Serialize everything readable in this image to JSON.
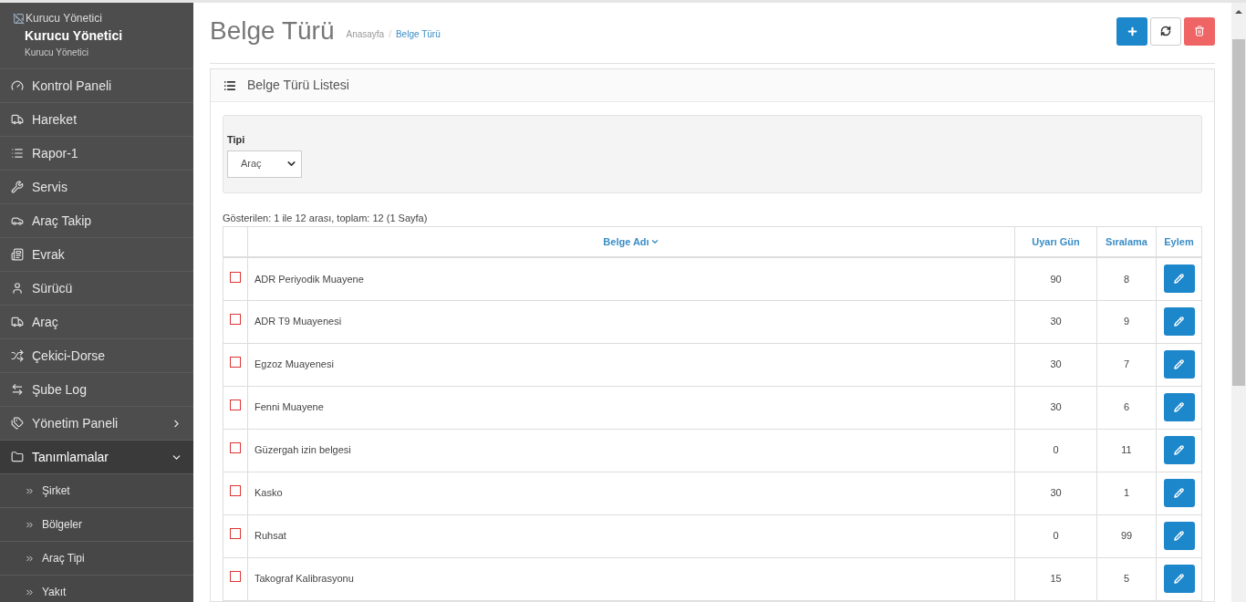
{
  "user": {
    "image_alt": "Kurucu Yönetici",
    "name": "Kurucu Yönetici",
    "role": "Kurucu Yönetici"
  },
  "sidebar": {
    "items": [
      {
        "label": "Kontrol Paneli",
        "selected": false
      },
      {
        "label": "Hareket",
        "selected": false
      },
      {
        "label": "Rapor-1",
        "selected": false
      },
      {
        "label": "Servis",
        "selected": false
      },
      {
        "label": "Araç Takip",
        "selected": false
      },
      {
        "label": "Evrak",
        "selected": false
      },
      {
        "label": "Sürücü",
        "selected": false
      },
      {
        "label": "Araç",
        "selected": false
      },
      {
        "label": "Çekici-Dorse",
        "selected": false
      },
      {
        "label": "Şube Log",
        "selected": false
      },
      {
        "label": "Yönetim Paneli",
        "selected": false,
        "expanded": false
      },
      {
        "label": "Tanımlamalar",
        "selected": true,
        "expanded": true,
        "children": [
          {
            "label": "Şirket"
          },
          {
            "label": "Bölgeler"
          },
          {
            "label": "Araç Tipi"
          },
          {
            "label": "Yakıt"
          }
        ]
      }
    ]
  },
  "page": {
    "title": "Belge Türü",
    "breadcrumb": [
      {
        "label": "Anasayfa",
        "current": false
      },
      {
        "label": "Belge Türü",
        "current": true
      }
    ],
    "breadcrumb_separator": "/"
  },
  "panel": {
    "title": "Belge Türü Listesi",
    "filter": {
      "label": "Tipi",
      "value": "Araç"
    },
    "summary": "Gösterilen: 1 ile 12 arası, toplam: 12 (1 Sayfa)",
    "table": {
      "columns": [
        {
          "label": "Belge Adı",
          "sorted": true
        },
        {
          "label": "Uyarı Gün",
          "sorted": false
        },
        {
          "label": "Sıralama",
          "sorted": false
        },
        {
          "label": "Eylem",
          "sorted": false
        }
      ],
      "rows": [
        {
          "checked": false,
          "name": "ADR Periyodik Muayene",
          "warning_days": "90",
          "order": "8"
        },
        {
          "checked": false,
          "name": "ADR T9 Muayenesi",
          "warning_days": "30",
          "order": "9"
        },
        {
          "checked": false,
          "name": "Egzoz Muayenesi",
          "warning_days": "30",
          "order": "7"
        },
        {
          "checked": false,
          "name": "Fenni Muayene",
          "warning_days": "30",
          "order": "6"
        },
        {
          "checked": false,
          "name": "Güzergah izin belgesi",
          "warning_days": "0",
          "order": "11"
        },
        {
          "checked": false,
          "name": "Kasko",
          "warning_days": "30",
          "order": "1"
        },
        {
          "checked": false,
          "name": "Ruhsat",
          "warning_days": "0",
          "order": "99"
        },
        {
          "checked": false,
          "name": "Takograf Kalibrasyonu",
          "warning_days": "15",
          "order": "5"
        }
      ]
    }
  }
}
